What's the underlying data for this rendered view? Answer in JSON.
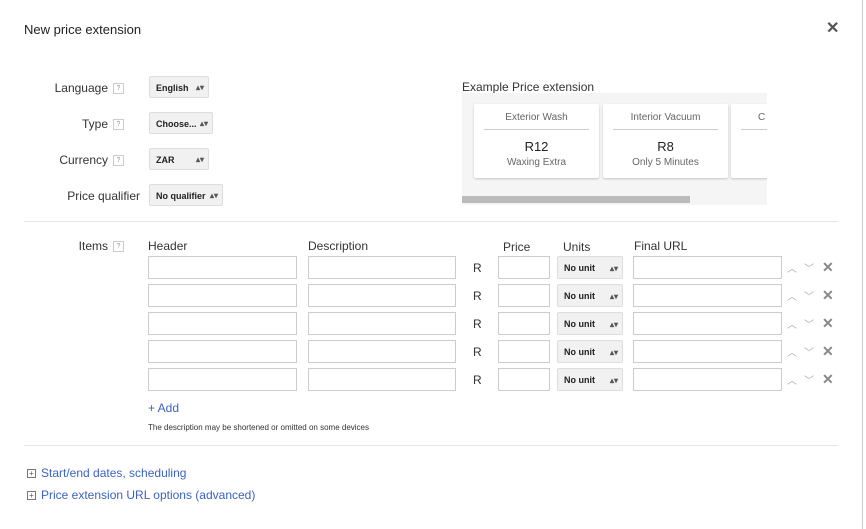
{
  "dialog": {
    "title": "New price extension",
    "close_icon": "close-icon"
  },
  "fields": {
    "language": {
      "label": "Language",
      "value": "English"
    },
    "type": {
      "label": "Type",
      "value": "Choose..."
    },
    "currency": {
      "label": "Currency",
      "value": "ZAR"
    },
    "qualifier": {
      "label": "Price qualifier",
      "value": "No qualifier"
    },
    "help": "?"
  },
  "preview": {
    "title": "Example Price extension",
    "cards": [
      {
        "header": "Exterior Wash",
        "price": "R12",
        "desc": "Waxing Extra"
      },
      {
        "header": "Interior Vacuum",
        "price": "R8",
        "desc": "Only 5 Minutes"
      },
      {
        "header": "C",
        "price": "",
        "desc": ""
      }
    ]
  },
  "items": {
    "label": "Items",
    "columns": {
      "header": "Header",
      "description": "Description",
      "price": "Price",
      "units": "Units",
      "url": "Final URL"
    },
    "currency_symbol": "R",
    "unit_value": "No unit",
    "rows": [
      {},
      {},
      {},
      {},
      {}
    ],
    "add": "+ Add",
    "note": "The description may be shortened or omitted on some devices"
  },
  "sections": {
    "scheduling": "Start/end dates, scheduling",
    "url_options": "Price extension URL options (advanced)"
  }
}
